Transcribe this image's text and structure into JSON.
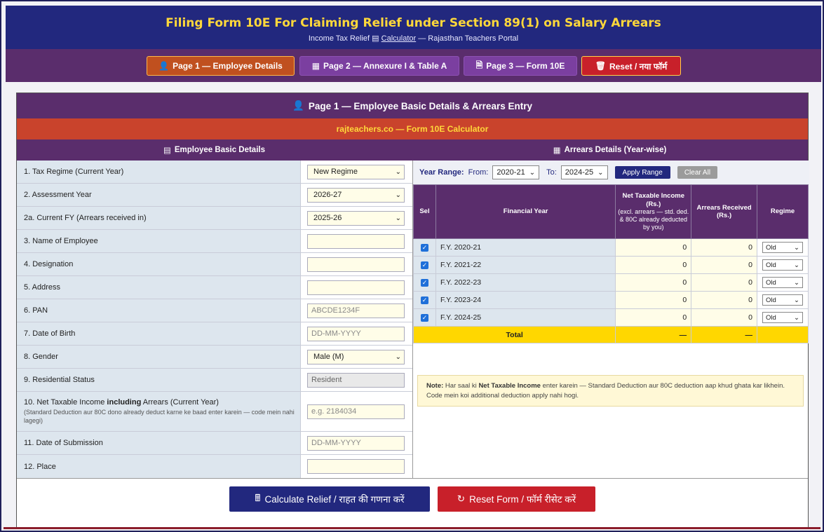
{
  "header": {
    "title": "Filing Form 10E For Claiming Relief under Section 89(1) on Salary Arrears",
    "sub_prefix": "Income Tax Relief",
    "sub_link": "Calculator",
    "sub_suffix": "— Rajasthan Teachers Portal"
  },
  "nav": {
    "page1": "Page 1 — Employee Details",
    "page2": "Page 2 — Annexure I & Table A",
    "page3": "Page 3 — Form 10E",
    "reset": "Reset / नया फॉर्म"
  },
  "card": {
    "title": "Page 1 — Employee Basic Details & Arrears Entry",
    "subtitle": "rajteachers.co — Form 10E Calculator",
    "left_head": "Employee Basic Details",
    "right_head": "Arrears Details (Year-wise)"
  },
  "fields": {
    "f1": {
      "label": "1. Tax Regime (Current Year)",
      "value": "New Regime"
    },
    "f2": {
      "label": "2. Assessment Year",
      "value": "2026-27"
    },
    "f2a": {
      "label": "2a. Current FY (Arrears received in)",
      "value": "2025-26"
    },
    "f3": {
      "label": "3. Name of Employee",
      "value": ""
    },
    "f4": {
      "label": "4. Designation",
      "value": ""
    },
    "f5": {
      "label": "5. Address",
      "value": ""
    },
    "f6": {
      "label": "6. PAN",
      "placeholder": "ABCDE1234F"
    },
    "f7": {
      "label": "7. Date of Birth",
      "placeholder": "DD-MM-YYYY"
    },
    "f8": {
      "label": "8. Gender",
      "value": "Male (M)"
    },
    "f9": {
      "label": "9. Residential Status",
      "value": "Resident"
    },
    "f10": {
      "label_a": "10. Net Taxable Income ",
      "label_b": "including",
      "label_c": " Arrears (Current Year)",
      "note": "(Standard Deduction aur 80C dono already deduct karne ke baad enter karein — code mein nahi lagegi)",
      "placeholder": "e.g. 2184034"
    },
    "f11": {
      "label": "11. Date of Submission",
      "placeholder": "DD-MM-YYYY"
    },
    "f12": {
      "label": "12. Place",
      "value": ""
    }
  },
  "range": {
    "label": "Year Range:",
    "from_label": "From:",
    "from": "2020-21",
    "to_label": "To:",
    "to": "2024-25",
    "apply": "Apply Range",
    "clear": "Clear All"
  },
  "table": {
    "head_sel": "Sel",
    "head_fy": "Financial Year",
    "head_nti": "Net Taxable Income",
    "head_nti_rs": "(Rs.)",
    "head_nti_note": "(excl. arrears — std. ded. & 80C already deducted by you)",
    "head_arr": "Arrears Received",
    "head_arr_rs": "(Rs.)",
    "head_regime": "Regime",
    "rows": [
      {
        "fy": "F.Y. 2020-21",
        "nti": "0",
        "arr": "0",
        "regime": "Old"
      },
      {
        "fy": "F.Y. 2021-22",
        "nti": "0",
        "arr": "0",
        "regime": "Old"
      },
      {
        "fy": "F.Y. 2022-23",
        "nti": "0",
        "arr": "0",
        "regime": "Old"
      },
      {
        "fy": "F.Y. 2023-24",
        "nti": "0",
        "arr": "0",
        "regime": "Old"
      },
      {
        "fy": "F.Y. 2024-25",
        "nti": "0",
        "arr": "0",
        "regime": "Old"
      }
    ],
    "total_label": "Total",
    "total_nti": "—",
    "total_arr": "—"
  },
  "note": {
    "prefix": "Note:",
    "t1": " Har saal ki ",
    "bold": "Net Taxable Income",
    "t2": " enter karein — Standard Deduction aur 80C deduction aap khud ghata kar likhein. Code mein koi additional deduction apply nahi hogi."
  },
  "footer": {
    "calc": "Calculate Relief / राहत की गणना करें",
    "reset": "Reset Form / फॉर्म रीसेट करें"
  },
  "colors": {
    "purple": "#5a2d6c",
    "navy": "#22287e",
    "orange": "#c9432c",
    "gold": "#ffd83a",
    "red": "#c8202a"
  }
}
